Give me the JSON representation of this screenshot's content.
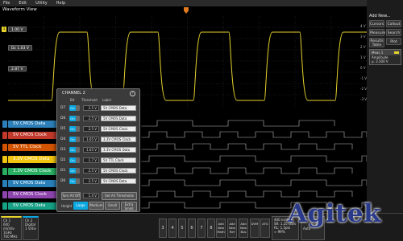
{
  "menu": [
    "File",
    "Edit",
    "Utility",
    "Help"
  ],
  "waveform_view": {
    "title": "Waveform View"
  },
  "channels": {
    "ch1_scale": "1.00 V",
    "ch_offset": "Dc 1.03 V",
    "ch_offset2": "2.87 V"
  },
  "lanes": [
    {
      "label": "5V CMOS Data",
      "color": "#2c7fb8"
    },
    {
      "label": "5V CMOS Clock",
      "color": "#c0392b"
    },
    {
      "label": "5V TTL Clock",
      "color": "#d35400"
    },
    {
      "label": "3.3V CMOS Data",
      "color": "#f1c40f"
    },
    {
      "label": "3.3V CMOS Clock",
      "color": "#27ae60"
    },
    {
      "label": "5V CMOS Data",
      "color": "#2980b9"
    },
    {
      "label": "5V CMOS Clock",
      "color": "#8e44ad"
    },
    {
      "label": "5V CMOS Data",
      "color": "#16a085"
    }
  ],
  "right_panel": {
    "add_new": "Add New...",
    "buttons": [
      "Cursors",
      "Callout",
      "Measure",
      "Search",
      "Results Table",
      "Plot"
    ],
    "meas_title": "Meas 1",
    "meas_name": "Amplitude",
    "meas_value": "μ: 3.500 V"
  },
  "y_axis": [
    "4 V",
    "3 V",
    "2 V",
    "1 V",
    "0 V",
    "-1 V",
    "-2 V",
    "-3 V"
  ],
  "dialog": {
    "title": "CHANNEL 2",
    "help": "?",
    "col_bit": "Bit",
    "col_threshold": "Threshold",
    "col_label": "Label",
    "rows": [
      {
        "bit": "D7",
        "state": "On",
        "threshold": "2.5 V",
        "label": "5V CMOS Data"
      },
      {
        "bit": "D6",
        "state": "On",
        "threshold": "2.5 V",
        "label": "5V CMOS Data"
      },
      {
        "bit": "D5",
        "state": "On",
        "threshold": "2.5 V",
        "label": "5V CMOS Clock"
      },
      {
        "bit": "D4",
        "state": "On",
        "threshold": "1.65 V",
        "label": "3.3V CMOS Clock"
      },
      {
        "bit": "D3",
        "state": "On",
        "threshold": "1.65 V",
        "label": "3.3V CMOS Data"
      },
      {
        "bit": "D2",
        "state": "On",
        "threshold": "1.7 V",
        "label": "5V TTL Clock"
      },
      {
        "bit": "D1",
        "state": "On",
        "threshold": "2.5 V",
        "label": "5V CMOS Clock"
      },
      {
        "bit": "D0",
        "state": "On",
        "threshold": "2.5 V",
        "label": "5V CMOS Data"
      }
    ],
    "turn_all_off": "Turn All Off",
    "all_threshold": "1.4 V",
    "set_all": "Set All Thresholds",
    "height_label": "Height",
    "height_options": [
      "Large",
      "Medium",
      "Small",
      "Extra Small"
    ]
  },
  "bottom": {
    "ch1_title": "Ch 1",
    "ch1_line1": "600 mV/div",
    "ch1_line2": "1GHz",
    "ch1_line3": "700 MHz",
    "ch2_title": "Ch 2",
    "ch2_line1": "Digital",
    "ch2_line2": "1 V/div",
    "channel_numbers": [
      "3",
      "4",
      "5",
      "6",
      "7",
      "8"
    ],
    "buttons": [
      "Add New Math",
      "Add New Ref",
      "Add New Bus",
      "DVM",
      "AFG"
    ],
    "acq_line1": "400 ns/div",
    "acq_line2": "SR: 1.25 GS/s",
    "acq_line3": "RL: 1.5pts",
    "acq_line4": "≈ 99%",
    "trigger_value": "2.84",
    "trigger_note": "Auto"
  },
  "watermark": "Agitek"
}
